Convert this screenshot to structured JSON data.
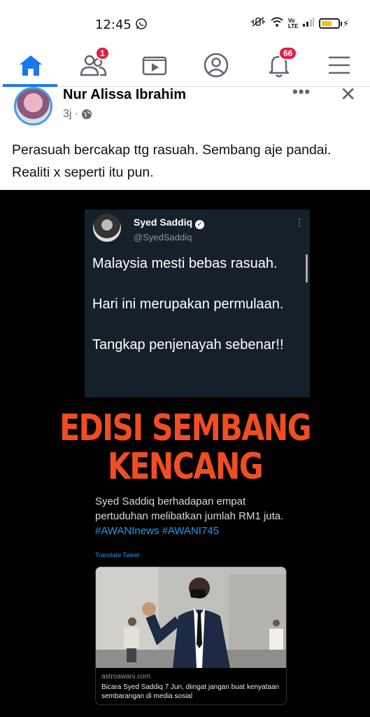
{
  "status_bar": {
    "time": "12:45",
    "icons": [
      "whatsapp-icon",
      "mute-icon",
      "wifi-icon",
      "volte-icon",
      "signal-icon",
      "battery-icon"
    ],
    "volte_text": "Vo LTE"
  },
  "nav": {
    "items": [
      {
        "name": "home",
        "icon": "home-icon",
        "active": true
      },
      {
        "name": "friends",
        "icon": "friends-icon",
        "badge": "1"
      },
      {
        "name": "watch",
        "icon": "video-icon"
      },
      {
        "name": "profile",
        "icon": "profile-icon"
      },
      {
        "name": "notifications",
        "icon": "bell-icon",
        "badge": "66"
      },
      {
        "name": "menu",
        "icon": "hamburger-icon"
      }
    ],
    "accent": "#1877f2",
    "badge_color": "#e41e3f"
  },
  "post": {
    "author": "Nur Alissa Ibrahim",
    "time": "3j ·",
    "text": "Perasuah bercakap ttg rasuah.  Sembang aje pandai.  Realiti x seperti itu pun."
  },
  "image": {
    "tweet": {
      "name": "Syed Saddiq",
      "handle": "@SyedSaddiq",
      "lines": [
        "Malaysia mesti bebas rasuah.",
        "Hari ini merupakan permulaan.",
        "Tangkap penjenayah sebenar!!"
      ]
    },
    "headline_1": "EDISI SEMBANG",
    "headline_2": "KENCANG",
    "headline_color": "#f04e22",
    "caption": "Syed Saddiq berhadapan empat pertuduhan melibatkan jumlah RM1 juta.",
    "caption_tags": "#AWANInews #AWANI745",
    "translate": "Translate Tweet",
    "link_domain": "astroawani.com",
    "link_title": "Bicara Syed Saddiq 7 Jun, diingat jangan buat kenyataan sembarangan di media sosial"
  }
}
